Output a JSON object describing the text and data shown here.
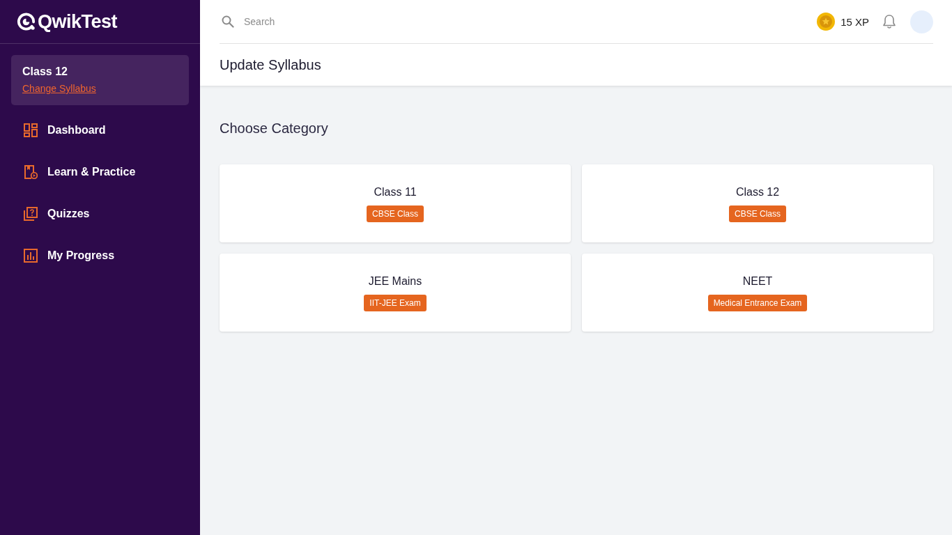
{
  "sidebar": {
    "logo": "QwikTest",
    "syllabus_card": {
      "title": "Class 12",
      "link": "Change Syllabus"
    },
    "items": [
      {
        "label": "Dashboard",
        "selected": false
      },
      {
        "label": "Learn & Practice",
        "selected": false
      },
      {
        "label": "Quizzes",
        "selected": false
      },
      {
        "label": "My Progress",
        "selected": false
      }
    ]
  },
  "topbar": {
    "search": {
      "placeholder": "Search"
    },
    "xp": "15 XP"
  },
  "page": {
    "title": "Update Syllabus",
    "section_title": "Choose Category",
    "categories": [
      {
        "name": "Class 11",
        "tag": "CBSE Class"
      },
      {
        "name": "Class 12",
        "tag": "CBSE Class"
      },
      {
        "name": "JEE Mains",
        "tag": "IIT-JEE Exam"
      },
      {
        "name": "NEET",
        "tag": "Medical Entrance Exam"
      }
    ]
  }
}
